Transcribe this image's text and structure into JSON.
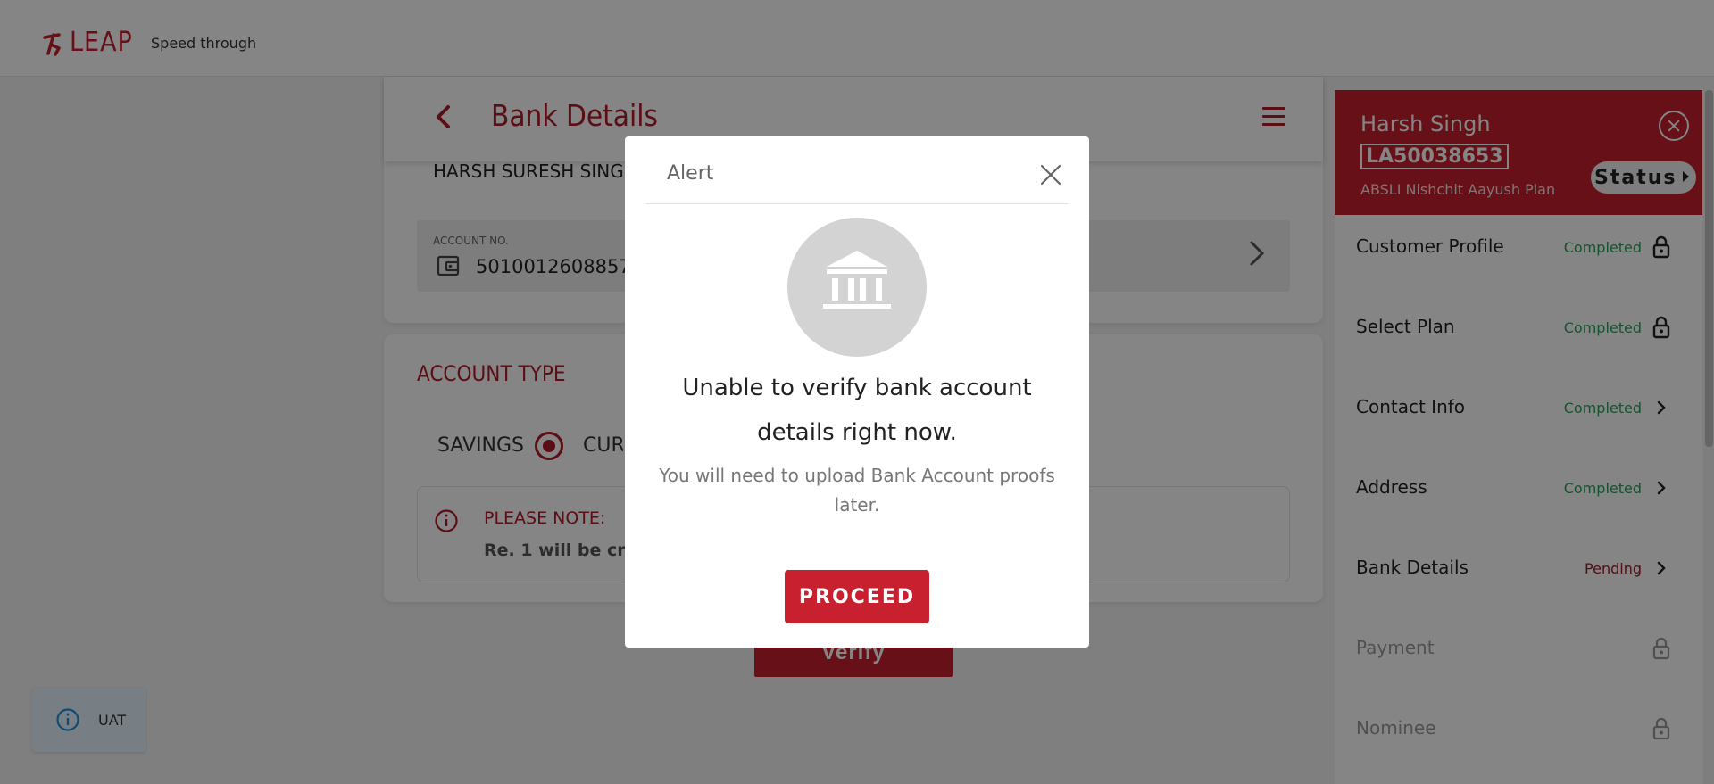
{
  "header": {
    "logo_text": "LEAP",
    "tagline": "Speed through"
  },
  "page": {
    "title": "Bank Details",
    "holder_name": "HARSH SURESH SINGH",
    "account_label": "ACCOUNT NO.",
    "account_number": "50100126088575",
    "account_type_title": "ACCOUNT TYPE",
    "savings_label": "SAVINGS",
    "current_label": "CURRENT",
    "note_title": "PLEASE NOTE:",
    "note_text": "Re. 1 will be credited",
    "verify_label": "Verify"
  },
  "sidebar": {
    "customer_name": "Harsh Singh",
    "application_id": "LA50038653",
    "plan_name": "ABSLI Nishchit Aayush Plan",
    "status_label": "Status",
    "steps": [
      {
        "label": "Customer Profile",
        "status": "Completed",
        "icon": "lock-icon"
      },
      {
        "label": "Select Plan",
        "status": "Completed",
        "icon": "lock-icon"
      },
      {
        "label": "Contact Info",
        "status": "Completed",
        "icon": "chevron-right-icon"
      },
      {
        "label": "Address",
        "status": "Completed",
        "icon": "chevron-right-icon"
      },
      {
        "label": "Bank Details",
        "status": "Pending",
        "icon": "chevron-right-icon"
      },
      {
        "label": "Payment",
        "status": "",
        "icon": "lock-icon"
      },
      {
        "label": "Nominee",
        "status": "",
        "icon": "lock-icon"
      }
    ]
  },
  "env_badge": {
    "label": "UAT"
  },
  "modal": {
    "title": "Alert",
    "heading": "Unable to verify bank account details right now.",
    "message": "You will need to upload Bank Account proofs later.",
    "proceed_label": "PROCEED",
    "icon": "bank-icon"
  },
  "colors": {
    "brand_red": "#c8202f",
    "title_red": "#b01c2a",
    "completed_green": "#2e9e5a",
    "pending_red": "#9b1b26",
    "overlay": "rgba(0,0,0,0.48)"
  }
}
